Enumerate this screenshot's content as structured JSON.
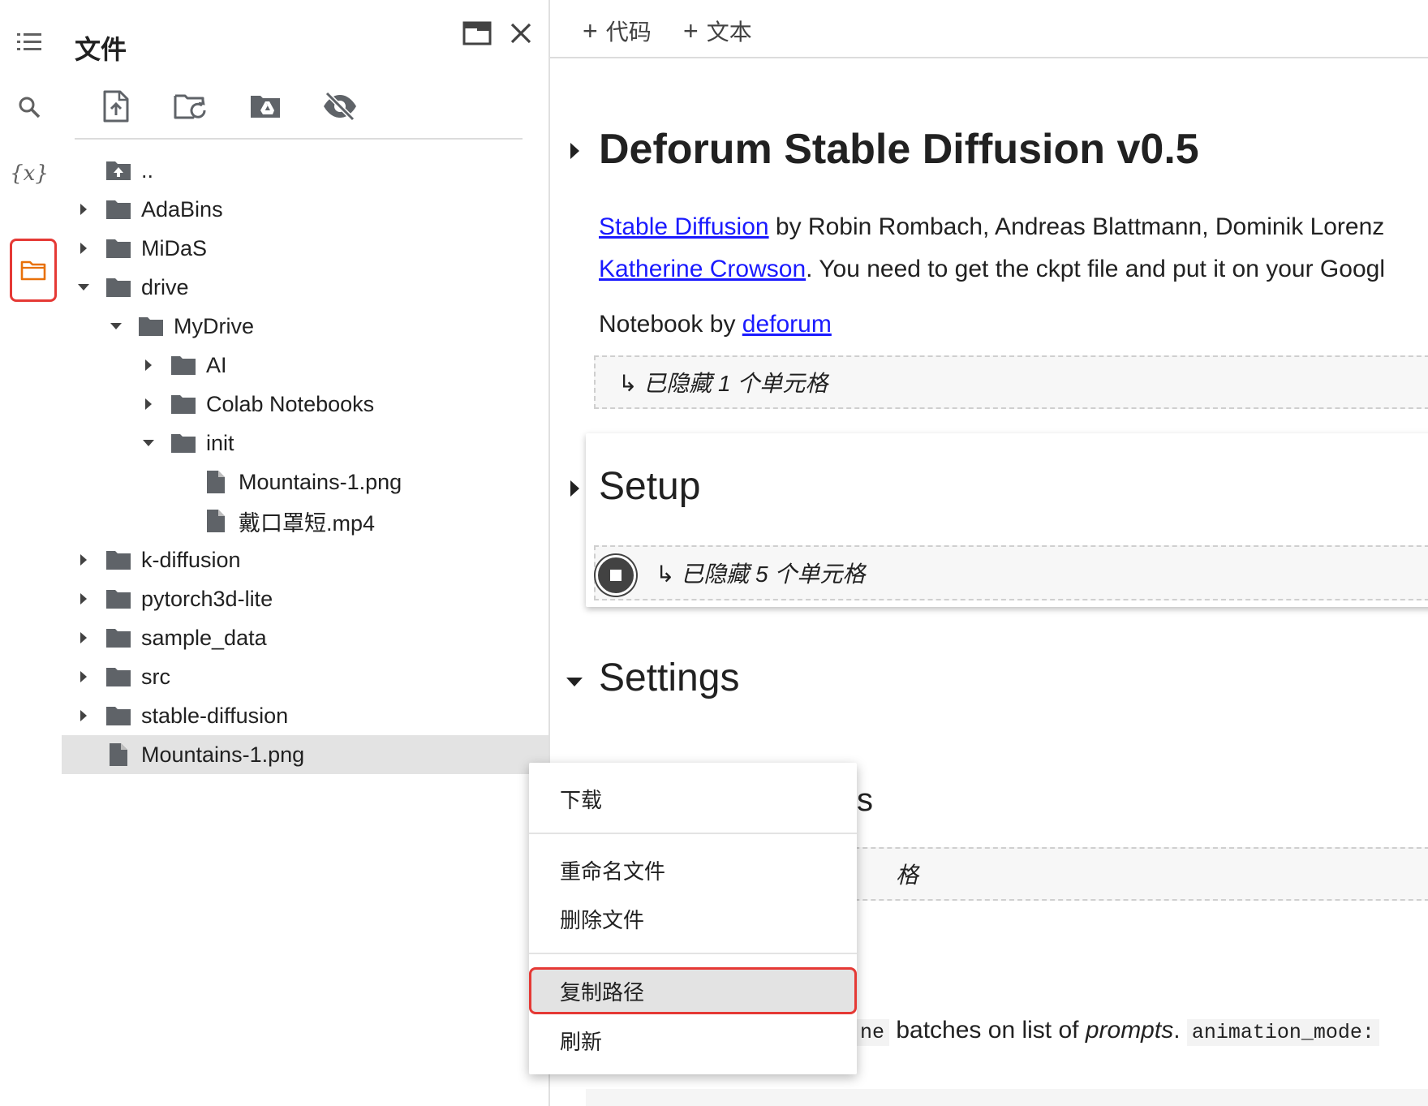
{
  "rail": {
    "items": [
      {
        "name": "table-of-contents",
        "icon": "toc-icon"
      },
      {
        "name": "search",
        "icon": "search-icon"
      },
      {
        "name": "variables",
        "icon": "variables-icon",
        "label": "{x}"
      },
      {
        "name": "files",
        "icon": "folder-icon",
        "active": true
      }
    ],
    "active_color": "#e8710a"
  },
  "files_panel": {
    "title": "文件",
    "toolbar": [
      {
        "name": "upload",
        "icon": "upload-file-icon"
      },
      {
        "name": "refresh",
        "icon": "folder-refresh-icon"
      },
      {
        "name": "mount-drive",
        "icon": "drive-folder-icon"
      },
      {
        "name": "toggle-hidden",
        "icon": "eye-off-icon"
      }
    ],
    "tree": [
      {
        "label": "..",
        "type": "parent",
        "depth": 0,
        "caret": "none"
      },
      {
        "label": "AdaBins",
        "type": "folder",
        "depth": 0,
        "caret": "right"
      },
      {
        "label": "MiDaS",
        "type": "folder",
        "depth": 0,
        "caret": "right"
      },
      {
        "label": "drive",
        "type": "folder",
        "depth": 0,
        "caret": "down"
      },
      {
        "label": "MyDrive",
        "type": "folder",
        "depth": 1,
        "caret": "down"
      },
      {
        "label": "AI",
        "type": "folder",
        "depth": 2,
        "caret": "right"
      },
      {
        "label": "Colab Notebooks",
        "type": "folder",
        "depth": 2,
        "caret": "right"
      },
      {
        "label": "init",
        "type": "folder",
        "depth": 2,
        "caret": "down"
      },
      {
        "label": "Mountains-1.png",
        "type": "file",
        "depth": 3,
        "caret": "none"
      },
      {
        "label": "戴口罩短.mp4",
        "type": "file",
        "depth": 3,
        "caret": "none"
      },
      {
        "label": "k-diffusion",
        "type": "folder",
        "depth": 0,
        "caret": "right"
      },
      {
        "label": "pytorch3d-lite",
        "type": "folder",
        "depth": 0,
        "caret": "right"
      },
      {
        "label": "sample_data",
        "type": "folder",
        "depth": 0,
        "caret": "right"
      },
      {
        "label": "src",
        "type": "folder",
        "depth": 0,
        "caret": "right"
      },
      {
        "label": "stable-diffusion",
        "type": "folder",
        "depth": 0,
        "caret": "right"
      },
      {
        "label": "Mountains-1.png",
        "type": "file",
        "depth": 0,
        "caret": "none",
        "selected": true
      }
    ]
  },
  "notebook": {
    "toolbar": {
      "add_code": "代码",
      "add_text": "文本",
      "plus": "+"
    },
    "title": "Deforum Stable Diffusion v0.5",
    "para1": {
      "link1": "Stable Diffusion",
      "text1": " by Robin Rombach, Andreas Blattmann, Dominik Lorenz",
      "link2": "Katherine Crowson",
      "text2": ". You need to get the ckpt file and put it on your Googl"
    },
    "para2": {
      "text": "Notebook by ",
      "link": "deforum"
    },
    "hidden1": "↳ 已隐藏 1 个单元格",
    "setup_heading": "Setup",
    "hidden2": "↳ 已隐藏 5 个单元格",
    "settings_heading": "Settings",
    "partial_heading_tail": "s",
    "partial_hidden_tail": "格",
    "partial_line": {
      "code1": "ne",
      "text1": " batches on list of ",
      "em": "prompts",
      "text2": ". ",
      "code2": "animation_mode:"
    }
  },
  "context_menu": {
    "items": [
      {
        "label": "下载"
      },
      {
        "label": "重命名文件"
      },
      {
        "label": "删除文件"
      },
      {
        "label": "复制路径",
        "highlighted": true
      },
      {
        "label": "刷新"
      }
    ]
  }
}
